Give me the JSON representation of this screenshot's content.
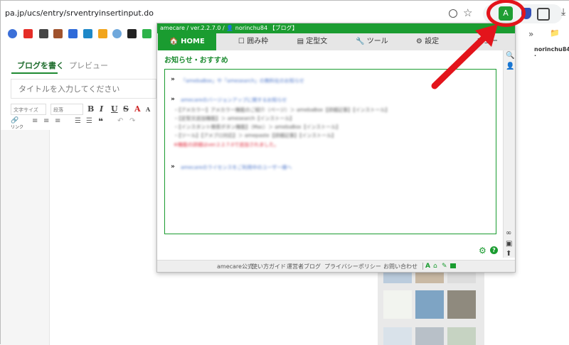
{
  "browser": {
    "url": "pa.jp/ucs/entry/srventryinsertinput.do",
    "ext_icon_label": "A"
  },
  "page": {
    "tab_write": "ブログを書く",
    "tab_preview": "プレビュー",
    "title_placeholder": "タイトルを入力してください",
    "font_size_select": "文字サイズ",
    "paragraph_select": "段落",
    "link_label": "リンク",
    "user_name": "norinchu84 ·"
  },
  "popup": {
    "title": "amecare / ver.2.2.7.0 / 👤 norinchu84 【ブログ】",
    "nav": {
      "home": "🏠 HOME",
      "frame": "☐ 囲み枠",
      "template": "▤ 定型文",
      "tools": "🔧 ツール",
      "settings": "⚙ 設定",
      "menu": "ニュー"
    },
    "heading": "お知らせ・おすすめ",
    "news": [
      "「amebaBox」や「amesearch」の無料化のお知らせ",
      "amecareのバージョンアップに関するお知らせ",
      "・【アメカラー】アメカラー機能のご紹介（ページ）＞ amebaBox【詳細記事】【インストール】",
      "・【定型文追加機能】＞ amesearch【インストール】",
      "・【インスタント検索ボタン機能】（Mac）＞ amebaBox【インストール】",
      "・【ツール】【アメブロ対応】＞ amepaste【詳細記事】【インストール】",
      "※機能の詳細はver.2.2.7.0で追加されました。",
      "amecareのライセンスをご利用中のユーザー様へ"
    ],
    "footer": {
      "official": "amecare公式",
      "guide": "使い方ガイド",
      "blog": "運営者ブログ",
      "privacy": "プライバシーポリシー",
      "contact": "お問い合わせ"
    }
  },
  "colors": {
    "brand_green": "#1a9c30",
    "annotation_red": "#e3141b"
  }
}
